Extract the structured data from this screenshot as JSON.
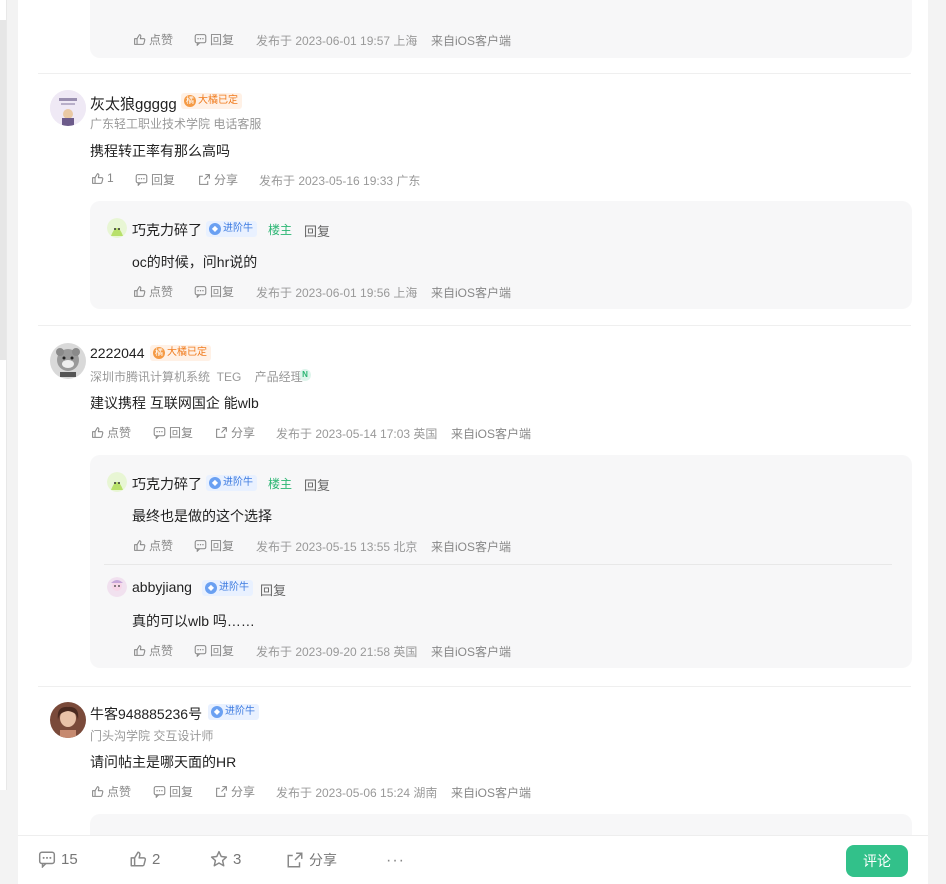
{
  "actions": {
    "like": "点赞",
    "reply": "回复",
    "share": "分享",
    "source_ios": "来自iOS客户端"
  },
  "top_reply": {
    "time": "发布于 2023-06-01 19:57 上海"
  },
  "comments": [
    {
      "user": "灰太狼ggggg",
      "badge": "大橘已定",
      "sub": "广东轻工职业技术学院 电话客服",
      "text": "携程转正率有那么高吗",
      "likes": "1",
      "time": "发布于 2023-05-16 19:33 广东",
      "replies": [
        {
          "user": "巧克力碎了",
          "badge": "进阶牛",
          "tag": "楼主",
          "reply_label": "回复",
          "text": "oc的时候，问hr说的",
          "time": "发布于 2023-06-01 19:56 上海"
        }
      ]
    },
    {
      "user": "2222044",
      "badge": "大橘已定",
      "sub": "深圳市腾讯计算机系统  TEG    产品经理",
      "n_badge": "N",
      "text": "建议携程 互联网国企 能wlb",
      "time": "发布于 2023-05-14 17:03 英国",
      "replies": [
        {
          "user": "巧克力碎了",
          "badge": "进阶牛",
          "tag": "楼主",
          "reply_label": "回复",
          "text": "最终也是做的这个选择",
          "time": "发布于 2023-05-15 13:55 北京"
        },
        {
          "user": "abbyjiang",
          "badge": "进阶牛",
          "reply_label": "回复",
          "text": "真的可以wlb 吗……",
          "time": "发布于 2023-09-20 21:58 英国"
        }
      ]
    },
    {
      "user": "牛客948885236号",
      "badge": "进阶牛",
      "sub": "门头沟学院 交互设计师",
      "text": "请问帖主是哪天面的HR",
      "time": "发布于 2023-05-06 15:24 湖南"
    }
  ],
  "bottom_bar": {
    "comments": "15",
    "likes": "2",
    "stars": "3",
    "share": "分享",
    "more": "···",
    "comment_button": "评论"
  },
  "colors": {
    "accent_green": "#32c18a",
    "orange_badge": "#f07b1d",
    "blue_badge": "#3d7be0"
  }
}
